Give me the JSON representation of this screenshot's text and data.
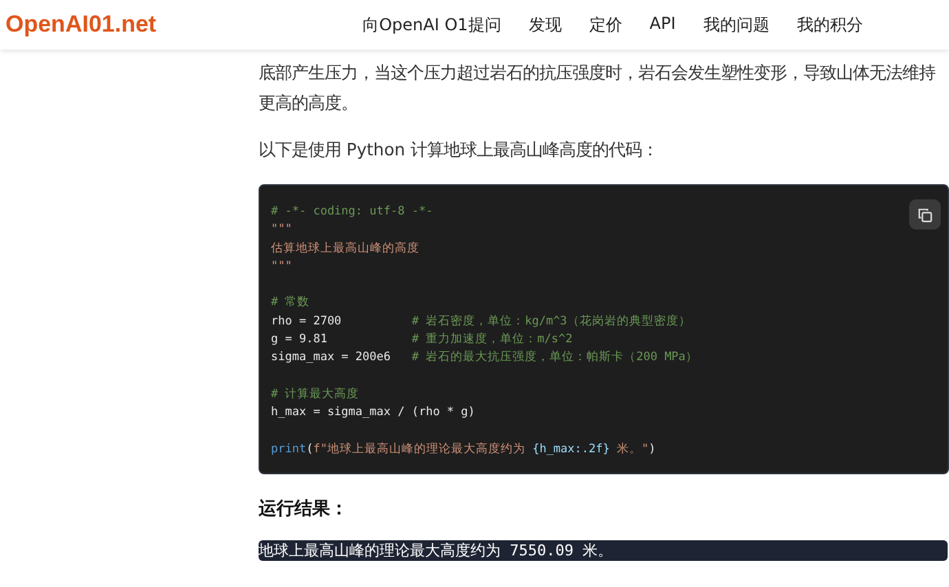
{
  "header": {
    "logo": "OpenAI01.net",
    "nav": [
      {
        "label": "向OpenAI O1提问"
      },
      {
        "label": "发现"
      },
      {
        "label": "定价"
      },
      {
        "label": "API"
      },
      {
        "label": "我的问题"
      },
      {
        "label": "我的积分"
      }
    ]
  },
  "article": {
    "paragraphs": [
      "底部产生压力，当这个压力超过岩石的抗压强度时，岩石会发生塑性变形，导致山体无法维持更高的高度。",
      "以下是使用 Python 计算地球上最高山峰高度的代码："
    ],
    "code_lines": [
      {
        "kind": "code",
        "segments": [
          {
            "kind": "comment",
            "text": "# -*- coding: utf-8 -*-"
          }
        ]
      },
      {
        "kind": "code",
        "segments": [
          {
            "kind": "string",
            "text": "\"\"\""
          }
        ]
      },
      {
        "kind": "code",
        "segments": [
          {
            "kind": "string",
            "text": "估算地球上最高山峰的高度"
          }
        ]
      },
      {
        "kind": "code",
        "segments": [
          {
            "kind": "string",
            "text": "\"\"\""
          }
        ]
      },
      {
        "kind": "blank"
      },
      {
        "kind": "code",
        "segments": [
          {
            "kind": "comment",
            "text": "# 常数"
          }
        ]
      },
      {
        "kind": "code",
        "segments": [
          {
            "kind": "plain",
            "text": "rho = 2700          "
          },
          {
            "kind": "comment",
            "text": "# 岩石密度，单位：kg/m^3（花岗岩的典型密度）"
          }
        ]
      },
      {
        "kind": "code",
        "segments": [
          {
            "kind": "plain",
            "text": "g = 9.81            "
          },
          {
            "kind": "comment",
            "text": "# 重力加速度，单位：m/s^2"
          }
        ]
      },
      {
        "kind": "code",
        "segments": [
          {
            "kind": "plain",
            "text": "sigma_max = 200e6   "
          },
          {
            "kind": "comment",
            "text": "# 岩石的最大抗压强度，单位：帕斯卡（200 MPa）"
          }
        ]
      },
      {
        "kind": "blank"
      },
      {
        "kind": "code",
        "segments": [
          {
            "kind": "comment",
            "text": "# 计算最大高度"
          }
        ]
      },
      {
        "kind": "code",
        "segments": [
          {
            "kind": "plain",
            "text": "h_max = sigma_max / (rho * g)"
          }
        ]
      },
      {
        "kind": "blank"
      },
      {
        "kind": "code",
        "segments": [
          {
            "kind": "func",
            "text": "print"
          },
          {
            "kind": "plain",
            "text": "("
          },
          {
            "kind": "string",
            "text": "f\"地球上最高山峰的理论最大高度约为 "
          },
          {
            "kind": "interp",
            "text": "{h_max:.2f}"
          },
          {
            "kind": "string",
            "text": " 米。\""
          },
          {
            "kind": "plain",
            "text": ")"
          }
        ]
      }
    ],
    "result_heading": "运行结果：",
    "result_output": "地球上最高山峰的理论最大高度约为 7550.09 米。"
  }
}
